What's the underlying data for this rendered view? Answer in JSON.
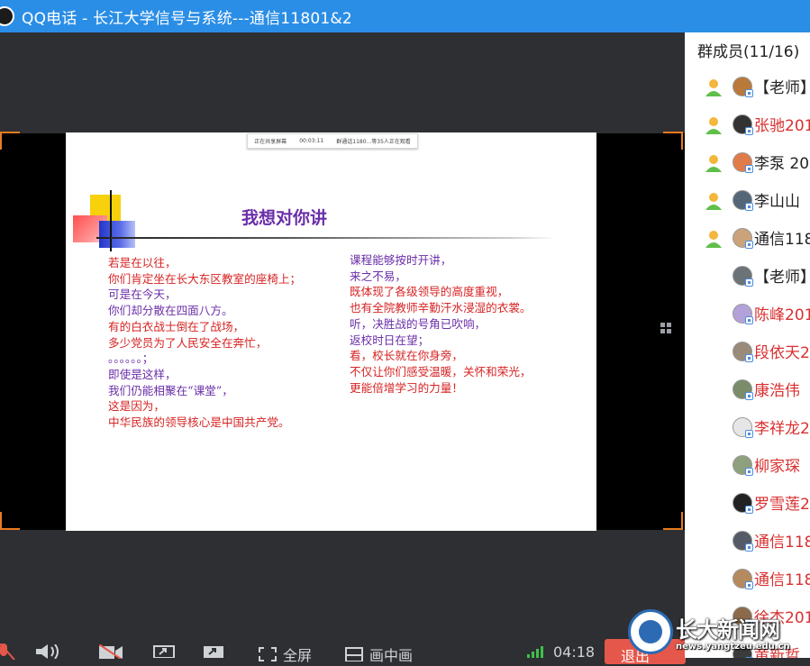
{
  "window": {
    "title": "QQ电话 - 长江大学信号与系统---通信11801&2"
  },
  "slide": {
    "mini_bar": {
      "left": "正在共享屏幕",
      "timer": "00:03:11",
      "right": "群通话1180...等35人正在观看"
    },
    "title": "我想对你讲",
    "left_lines": [
      {
        "text": "若是在以往，",
        "color": "red"
      },
      {
        "text": "你们肯定坐在长大东区教室的座椅上；",
        "color": "red"
      },
      {
        "text": "可是在今天，",
        "color": "purple"
      },
      {
        "text": "你们却分散在四面八方。",
        "color": "purple"
      },
      {
        "text": "有的白衣战士倒在了战场，",
        "color": "red"
      },
      {
        "text": "多少党员为了人民安全在奔忙，",
        "color": "red"
      },
      {
        "text": "。。。。。。；",
        "color": "purple"
      },
      {
        "text": "即使是这样，",
        "color": "purple"
      },
      {
        "text": "我们仍能相聚在“课堂”，",
        "color": "purple"
      },
      {
        "text": "这是因为，",
        "color": "red"
      },
      {
        "text": "中华民族的领导核心是中国共产党。",
        "color": "red"
      }
    ],
    "right_lines": [
      {
        "text": "课程能够按时开讲，",
        "color": "purple"
      },
      {
        "text": "来之不易，",
        "color": "purple"
      },
      {
        "text": "既体现了各级领导的高度重视，",
        "color": "red"
      },
      {
        "text": "也有全院教师辛勤汗水浸湿的衣裳。",
        "color": "red"
      },
      {
        "text": "听，决胜战的号角已吹响，",
        "color": "purple"
      },
      {
        "text": "返校时日在望；",
        "color": "purple"
      },
      {
        "text": "看，校长就在你身旁，",
        "color": "red"
      },
      {
        "text": "不仅让你们感受温暖，关怀和荣光，",
        "color": "red"
      },
      {
        "text": "更能倍增学习的力量！",
        "color": "red"
      }
    ]
  },
  "toolbar": {
    "fullscreen_label": "全屏",
    "pip_label": "画中画",
    "call_time": "04:18",
    "exit_label": "退出"
  },
  "members": {
    "header": "群成员(11/16)",
    "items": [
      {
        "name": "【老师】",
        "color": "black",
        "speaking": true,
        "avatar_color": "#b8793a"
      },
      {
        "name": "张驰201",
        "color": "red",
        "speaking": true,
        "avatar_color": "#333333"
      },
      {
        "name": "李泵 20",
        "color": "black",
        "speaking": true,
        "avatar_color": "#e27b4a"
      },
      {
        "name": "李山山",
        "color": "black",
        "speaking": true,
        "avatar_color": "#556677"
      },
      {
        "name": "通信118",
        "color": "black",
        "speaking": true,
        "avatar_color": "#caa37a"
      },
      {
        "name": "【老师】",
        "color": "black",
        "speaking": false,
        "avatar_color": "#6b7278"
      },
      {
        "name": "陈峰201",
        "color": "red",
        "speaking": false,
        "avatar_color": "#b3a1d9"
      },
      {
        "name": "段依天2",
        "color": "red",
        "speaking": false,
        "avatar_color": "#9a8a7a"
      },
      {
        "name": "康浩伟",
        "color": "red",
        "speaking": false,
        "avatar_color": "#7a8c6a"
      },
      {
        "name": "李祥龙2",
        "color": "red",
        "speaking": false,
        "avatar_color": "#e6e6e6"
      },
      {
        "name": "柳家琛",
        "color": "red",
        "speaking": false,
        "avatar_color": "#8fa07f"
      },
      {
        "name": "罗雪莲2",
        "color": "red",
        "speaking": false,
        "avatar_color": "#222222"
      },
      {
        "name": "通信118",
        "color": "red",
        "speaking": false,
        "avatar_color": "#555b66"
      },
      {
        "name": "通信118",
        "color": "red",
        "speaking": false,
        "avatar_color": "#b58a5e"
      },
      {
        "name": "徐杰201",
        "color": "red",
        "speaking": false,
        "avatar_color": "#8b6a4a"
      },
      {
        "name": "黄新哲",
        "color": "red",
        "speaking": false,
        "avatar_color": "#3b3b3b"
      }
    ]
  },
  "watermark": {
    "title": "长大新闻网",
    "url": "news.yangtzeu.edu.cn"
  },
  "colors": {
    "titlebar": "#2b8ee6",
    "accent_orange": "#e97b20",
    "exit_red": "#e5574a",
    "text_red": "#d72323",
    "text_purple": "#6a2ea8"
  },
  "icons": [
    "qq-icon",
    "mic-icon",
    "speaker-icon",
    "camera-off-icon",
    "share-screen-icon",
    "share-icon",
    "fullscreen-icon",
    "pip-icon",
    "signal-icon",
    "grid-icon",
    "person-speaking-icon"
  ]
}
